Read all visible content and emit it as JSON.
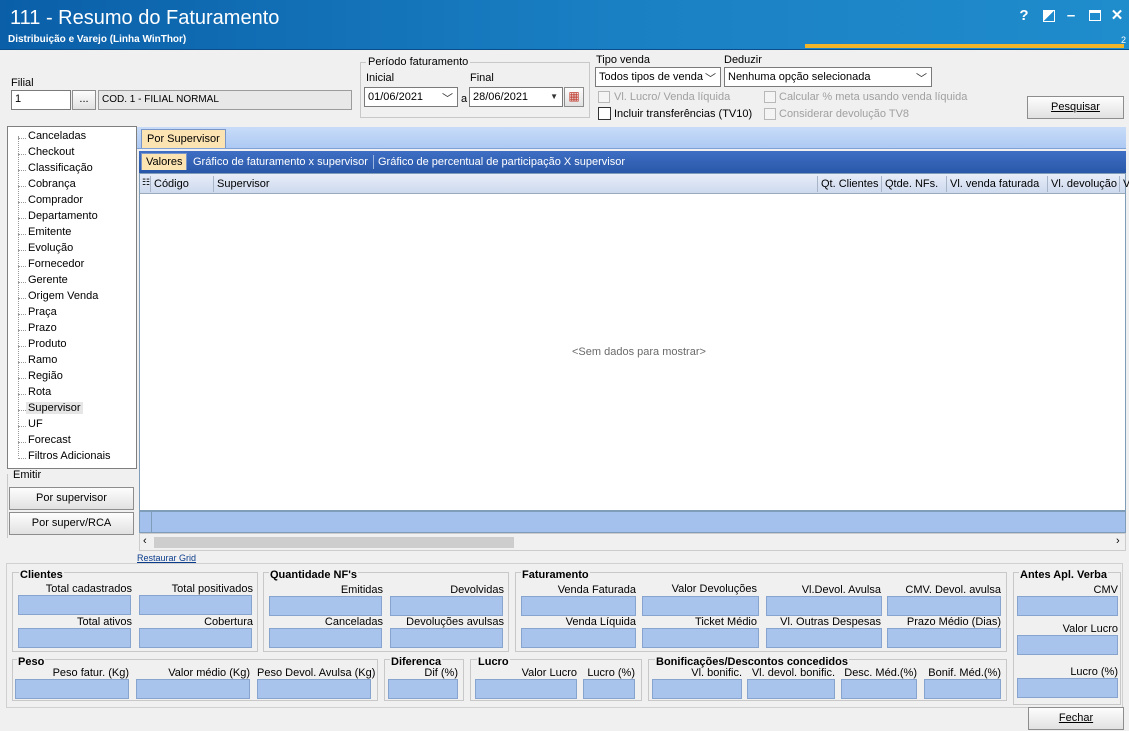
{
  "window": {
    "title": "111 - Resumo do Faturamento",
    "subtitle": "Distribuição e Varejo (Linha WinThor)",
    "version": "2"
  },
  "filial": {
    "label": "Filial",
    "value": "1",
    "browse": "...",
    "desc": "COD. 1 - FILIAL NORMAL"
  },
  "periodo": {
    "label": "Período faturamento",
    "inicial_label": "Inicial",
    "final_label": "Final",
    "inicial": "01/06/2021",
    "separator": "a",
    "final": "28/06/2021"
  },
  "tipo_venda": {
    "label": "Tipo venda",
    "value": "Todos tipos de venda"
  },
  "deduzir": {
    "label": "Deduzir",
    "value": "Nenhuma opção selecionada"
  },
  "options": {
    "lucro_liquida": "Vl. Lucro/ Venda líquida",
    "incluir_transf": "Incluir transferências  (TV10)",
    "calc_meta": "Calcular % meta usando venda líquida",
    "considerar_dev": "Considerar devolução TV8"
  },
  "buttons": {
    "pesquisar": "Pesquisar",
    "fechar": "Fechar",
    "por_supervisor": "Por supervisor",
    "por_superv_rca": "Por superv/RCA",
    "restaurar_grid": "Restaurar Grid",
    "emitir": "Emitir"
  },
  "tree": [
    "Canceladas",
    "Checkout",
    "Classificação",
    "Cobrança",
    "Comprador",
    "Departamento",
    "Emitente",
    "Evolução",
    "Fornecedor",
    "Gerente",
    "Origem Venda",
    "Praça",
    "Prazo",
    "Produto",
    "Ramo",
    "Região",
    "Rota",
    "Supervisor",
    "UF",
    "Forecast",
    "Filtros Adicionais"
  ],
  "main_tab": "Por Supervisor",
  "subtabs": [
    "Valores",
    "Gráfico de faturamento x supervisor",
    "Gráfico de percentual de participação X supervisor"
  ],
  "grid": {
    "columns": [
      "Código",
      "Supervisor",
      "Qt. Clientes",
      "Qtde. NFs.",
      "Vl. venda faturada",
      "Vl. devolução",
      "V"
    ],
    "empty": "<Sem dados para mostrar>"
  },
  "clientes": {
    "title": "Clientes",
    "fields": [
      "Total cadastrados",
      "Total positivados",
      "Total ativos",
      "Cobertura"
    ]
  },
  "quantidade": {
    "title": "Quantidade NF's",
    "fields": [
      "Emitidas",
      "Devolvidas",
      "Canceladas",
      "Devoluções avulsas"
    ]
  },
  "faturamento": {
    "title": "Faturamento",
    "fields": [
      "Venda Faturada",
      "Valor Devoluções",
      "Vl.Devol. Avulsa",
      "CMV. Devol. avulsa",
      "Venda Líquida",
      "Ticket Médio",
      "Vl. Outras Despesas",
      "Prazo Médio (Dias)"
    ]
  },
  "antes": {
    "title": "Antes Apl. Verba",
    "fields": [
      "CMV",
      "Valor Lucro",
      "Lucro (%)"
    ]
  },
  "peso": {
    "title": "Peso",
    "fields": [
      "Peso fatur. (Kg)",
      "Valor médio (Kg)",
      "Peso Devol. Avulsa (Kg)"
    ]
  },
  "diferenca": {
    "title": "Diferenca",
    "fields": [
      "Dif (%)"
    ]
  },
  "lucro": {
    "title": "Lucro",
    "fields": [
      "Valor Lucro",
      "Lucro (%)"
    ]
  },
  "bonif": {
    "title": "Bonificações/Descontos concedidos",
    "fields": [
      "Vl. bonific.",
      "Vl. devol. bonific.",
      "Desc. Méd.(%)",
      "Bonif. Méd.(%)"
    ]
  }
}
